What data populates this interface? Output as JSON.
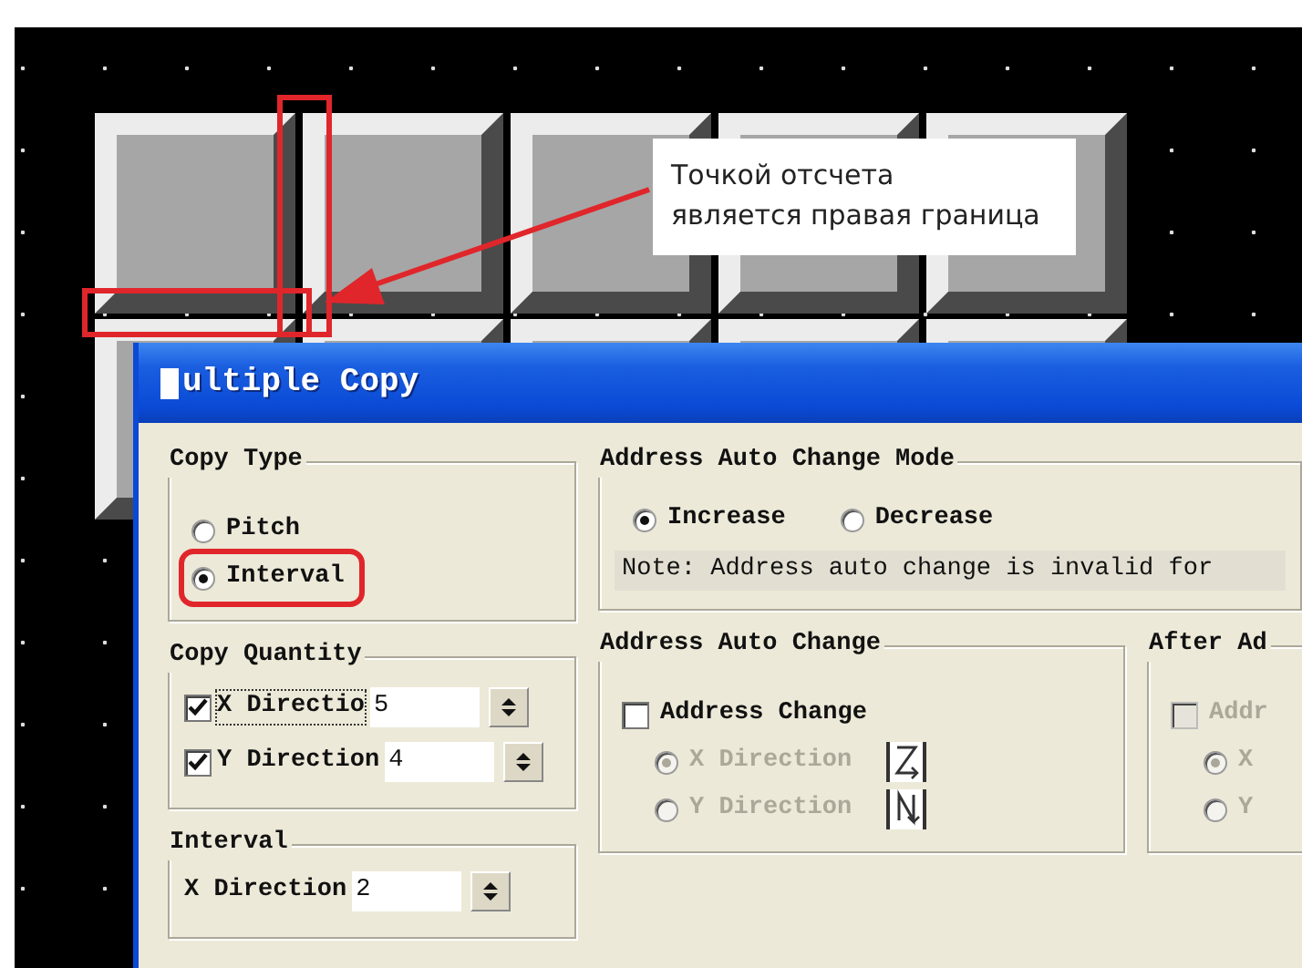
{
  "annotation": {
    "text": "Точкой отсчета\nявляется правая граница"
  },
  "dialog": {
    "title": "ultiple Copy",
    "copy_type": {
      "title": "Copy Type",
      "options": [
        {
          "label": "Pitch",
          "selected": false,
          "highlighted": false
        },
        {
          "label": "Interval",
          "selected": true,
          "highlighted": true
        }
      ]
    },
    "copy_quantity": {
      "title": "Copy Quantity",
      "rows": [
        {
          "label": "X Directio",
          "checked": true,
          "focused": true,
          "value": "5"
        },
        {
          "label": "Y Direction",
          "checked": true,
          "focused": false,
          "value": "4"
        }
      ]
    },
    "interval": {
      "title": "Interval",
      "rows": [
        {
          "label": "X Direction",
          "value": "2"
        }
      ]
    },
    "mode": {
      "title": "Address Auto Change Mode",
      "options": [
        {
          "label": "Increase",
          "selected": true
        },
        {
          "label": "Decrease",
          "selected": false
        }
      ],
      "note": "Note: Address auto change is invalid for"
    },
    "auto_change": {
      "title": "Address Auto Change",
      "checkbox": {
        "label": "Address Change",
        "checked": false,
        "disabled": false
      },
      "options": [
        {
          "label": "X Direction",
          "selected": true,
          "disabled": true,
          "kind": "z"
        },
        {
          "label": "Y Direction",
          "selected": false,
          "disabled": true,
          "kind": "n"
        }
      ]
    },
    "after": {
      "title": "After Ad",
      "checkbox": {
        "label": "Addr",
        "checked": false,
        "disabled": true
      },
      "options": [
        {
          "label": "X",
          "selected": true,
          "disabled": true
        },
        {
          "label": "Y",
          "selected": false,
          "disabled": true
        }
      ]
    }
  }
}
